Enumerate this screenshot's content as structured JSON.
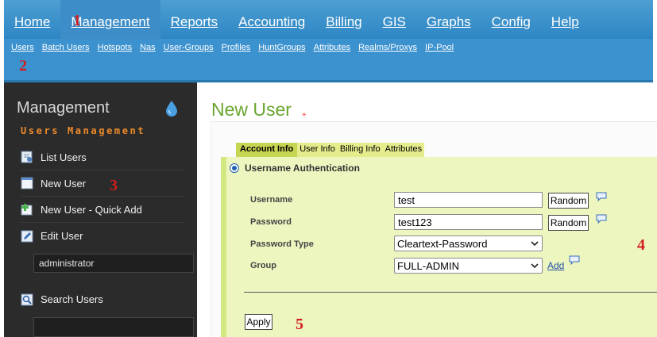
{
  "main_menu": {
    "items": [
      {
        "label": "Home"
      },
      {
        "label": "Management",
        "active": true
      },
      {
        "label": "Reports"
      },
      {
        "label": "Accounting"
      },
      {
        "label": "Billing"
      },
      {
        "label": "GIS"
      },
      {
        "label": "Graphs"
      },
      {
        "label": "Config"
      },
      {
        "label": "Help"
      }
    ]
  },
  "sub_menu": {
    "items": [
      "Users",
      "Batch Users",
      "Hotspots",
      "Nas",
      "User-Groups",
      "Profiles",
      "HuntGroups",
      "Attributes",
      "Realms/Proxys",
      "IP-Pool"
    ]
  },
  "annotations": [
    "1",
    "2",
    "3",
    "4",
    "5"
  ],
  "sidebar": {
    "title": "Management",
    "subtitle": "Users Management",
    "items": [
      {
        "label": "List Users",
        "icon": "list-users-icon"
      },
      {
        "label": "New User",
        "icon": "new-user-icon"
      },
      {
        "label": "New User - Quick Add",
        "icon": "quick-add-icon"
      },
      {
        "label": "Edit User",
        "icon": "edit-user-icon"
      },
      {
        "label": "Search Users",
        "icon": "search-users-icon"
      }
    ],
    "edit_user_value": "administrator",
    "search_value": ""
  },
  "page": {
    "title": "New User",
    "title_marker": "+"
  },
  "tabs": [
    "Account Info",
    "User Info",
    "Billing Info",
    "Attributes"
  ],
  "form": {
    "auth_option": "Username Authentication",
    "username_label": "Username",
    "username_value": "test",
    "password_label": "Password",
    "password_value": "test123",
    "password_type_label": "Password Type",
    "password_type_value": "Cleartext-Password",
    "group_label": "Group",
    "group_value": "FULL-ADMIN",
    "random_label": "Random",
    "add_label": "Add",
    "apply_label": "Apply"
  },
  "colors": {
    "nav_blue": "#3c92cf",
    "title_green": "#6aa52e",
    "sidebar_accent": "#ee8b2a",
    "panel_bg": "#eef6c0",
    "annotation_red": "#d11f1f"
  }
}
